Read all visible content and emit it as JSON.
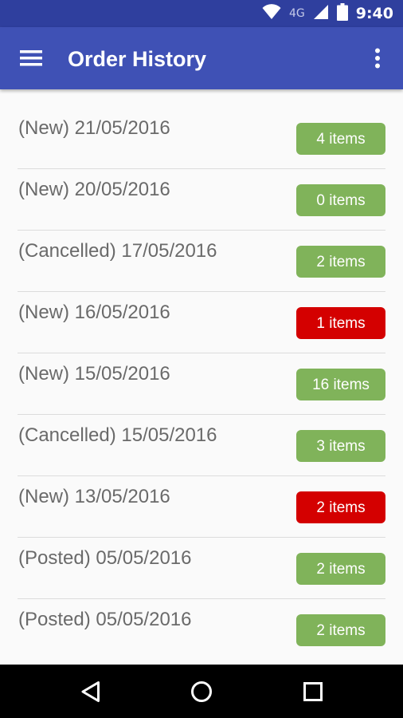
{
  "status_bar": {
    "network_label": "4G",
    "time": "9:40",
    "icons": [
      "wifi-icon",
      "signal-icon",
      "battery-icon"
    ]
  },
  "app_bar": {
    "title": "Order History",
    "menu_icon": "hamburger-menu-icon",
    "overflow_icon": "more-vert-icon",
    "color": "#3f51b5",
    "status_color": "#2f3f9e"
  },
  "orders": [
    {
      "label": "(New) 21/05/2016",
      "items": "4 items",
      "badge_color": "#80b35a"
    },
    {
      "label": "(New) 20/05/2016",
      "items": "0 items",
      "badge_color": "#80b35a"
    },
    {
      "label": "(Cancelled) 17/05/2016",
      "items": "2 items",
      "badge_color": "#80b35a"
    },
    {
      "label": "(New) 16/05/2016",
      "items": "1 items",
      "badge_color": "#d40000"
    },
    {
      "label": "(New) 15/05/2016",
      "items": "16 items",
      "badge_color": "#80b35a"
    },
    {
      "label": "(Cancelled) 15/05/2016",
      "items": "3 items",
      "badge_color": "#80b35a"
    },
    {
      "label": "(New) 13/05/2016",
      "items": "2 items",
      "badge_color": "#d40000"
    },
    {
      "label": "(Posted) 05/05/2016",
      "items": "2 items",
      "badge_color": "#80b35a"
    },
    {
      "label": "(Posted) 05/05/2016",
      "items": "2 items",
      "badge_color": "#80b35a"
    }
  ],
  "nav_bar": {
    "buttons": [
      "back-icon",
      "home-icon",
      "recents-icon"
    ]
  }
}
